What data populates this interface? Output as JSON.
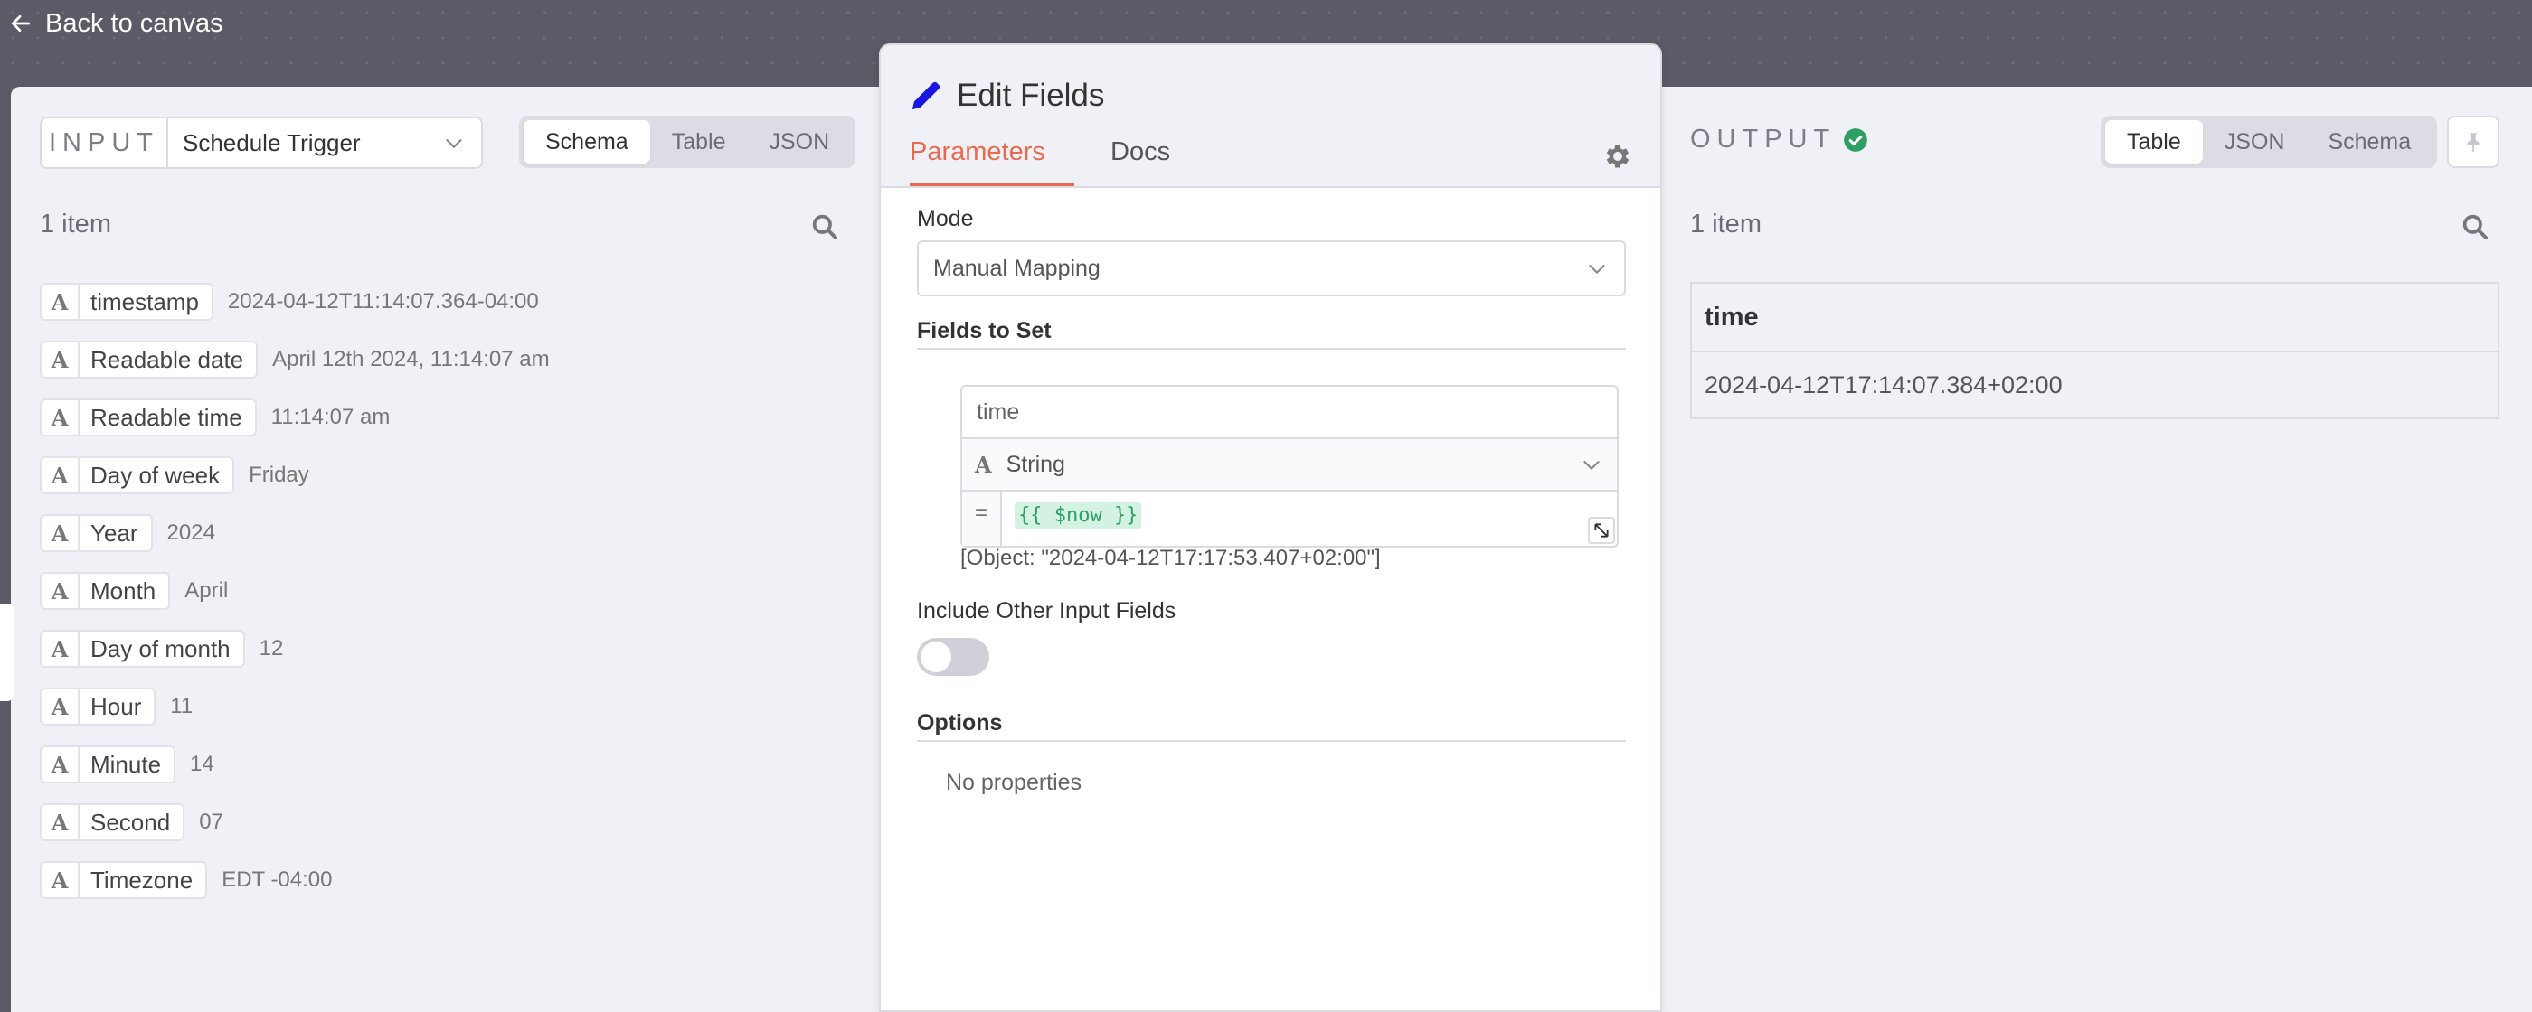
{
  "header": {
    "back_label": "Back to canvas"
  },
  "input": {
    "label": "INPUT",
    "source_node": "Schedule Trigger",
    "views": [
      "Schema",
      "Table",
      "JSON"
    ],
    "active_view": "Schema",
    "item_count": "1 item",
    "fields": [
      {
        "type_icon": "A",
        "name": "timestamp",
        "value": "2024-04-12T11:14:07.364-04:00"
      },
      {
        "type_icon": "A",
        "name": "Readable date",
        "value": "April 12th 2024, 11:14:07 am"
      },
      {
        "type_icon": "A",
        "name": "Readable time",
        "value": "11:14:07 am"
      },
      {
        "type_icon": "A",
        "name": "Day of week",
        "value": "Friday"
      },
      {
        "type_icon": "A",
        "name": "Year",
        "value": "2024"
      },
      {
        "type_icon": "A",
        "name": "Month",
        "value": "April"
      },
      {
        "type_icon": "A",
        "name": "Day of month",
        "value": "12"
      },
      {
        "type_icon": "A",
        "name": "Hour",
        "value": "11"
      },
      {
        "type_icon": "A",
        "name": "Minute",
        "value": "14"
      },
      {
        "type_icon": "A",
        "name": "Second",
        "value": "07"
      },
      {
        "type_icon": "A",
        "name": "Timezone",
        "value": "EDT -04:00"
      }
    ]
  },
  "node": {
    "title": "Edit Fields",
    "tabs": {
      "parameters": "Parameters",
      "docs": "Docs"
    },
    "mode_label": "Mode",
    "mode_value": "Manual Mapping",
    "fields_to_set_label": "Fields to Set",
    "assignment": {
      "name": "time",
      "type_icon": "A",
      "type": "String",
      "eq": "=",
      "expression": "{{ $now }}",
      "result": "[Object: \"2024-04-12T17:17:53.407+02:00\"]"
    },
    "include_other_label": "Include Other Input Fields",
    "include_other_enabled": false,
    "options_label": "Options",
    "no_properties": "No properties"
  },
  "output": {
    "label": "OUTPUT",
    "status": "success",
    "views": [
      "Table",
      "JSON",
      "Schema"
    ],
    "active_view": "Table",
    "item_count": "1 item",
    "columns": [
      "time"
    ],
    "rows": [
      [
        "2024-04-12T17:14:07.384+02:00"
      ]
    ]
  },
  "colors": {
    "accent": "#e96a50",
    "success": "#2f9e62",
    "canvas": "#5b5a66",
    "pencil": "#1a18e0"
  }
}
